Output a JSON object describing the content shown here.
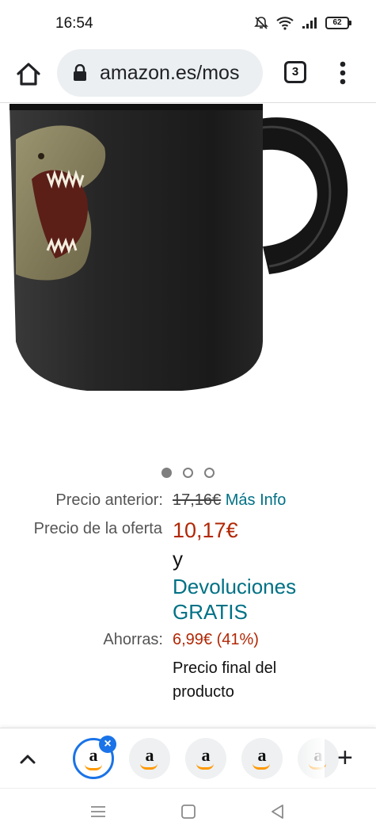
{
  "status_bar": {
    "time": "16:54",
    "battery": "62",
    "icons": [
      "mute-icon",
      "wifi-icon",
      "signal-icon",
      "battery-icon"
    ]
  },
  "browser": {
    "url": "amazon.es/mos",
    "tab_count": "3"
  },
  "gallery": {
    "image": "dinosaur-mug-image",
    "dots": 3,
    "active_dot": 0
  },
  "pricing": {
    "previous_label": "Precio anterior:",
    "previous_price": "17,16€",
    "more_info": "Más Info",
    "deal_label": "Precio de la oferta",
    "deal_price": "10,17€",
    "conjunction": "y",
    "returns_line1": "Devoluciones",
    "returns_line2": "GRATIS",
    "savings_label": "Ahorras:",
    "savings_value": "6,99€ (41%)",
    "final_line1": "Precio final del",
    "final_line2": "producto"
  },
  "tab_strip": {
    "tab_letter": "a",
    "tabs": 5
  },
  "colors": {
    "link": "#007185",
    "price": "#b12704",
    "accent": "#1a73e8",
    "amazon_orange": "#ff9900"
  }
}
